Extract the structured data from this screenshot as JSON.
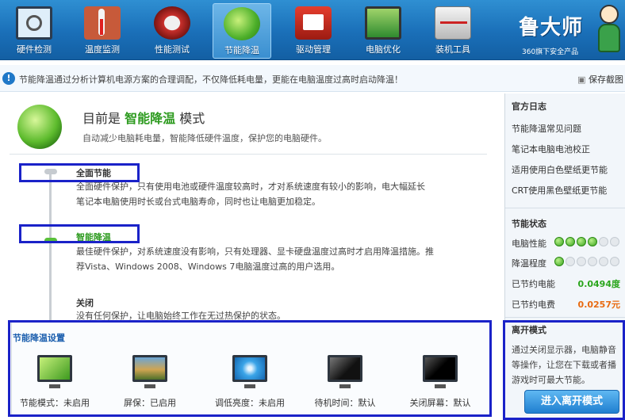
{
  "toolbar": {
    "tools": [
      {
        "label": "硬件检测",
        "icon": "monitor-magnifier-icon"
      },
      {
        "label": "温度监测",
        "icon": "thermometer-icon"
      },
      {
        "label": "性能测试",
        "icon": "gauge-icon"
      },
      {
        "label": "节能降温",
        "icon": "leaf-icon",
        "active": true
      },
      {
        "label": "驱动管理",
        "icon": "driver-box-icon"
      },
      {
        "label": "电脑优化",
        "icon": "screen-broom-icon"
      },
      {
        "label": "装机工具",
        "icon": "toolcase-icon"
      }
    ]
  },
  "brand": {
    "title": "鲁大师",
    "subtitle": "360旗下安全产品"
  },
  "notice": {
    "text": "节能降温通过分析计算机电源方案的合理调配，不仅降低耗电量，更能在电脑温度过高时启动降温！",
    "save_link": "保存截图"
  },
  "main": {
    "mode_prefix": "目前是",
    "mode_name": "智能降温",
    "mode_suffix": "模式",
    "mode_desc": "自动减少电脑耗电量，智能降低硬件温度，保护您的电脑硬件。",
    "options": [
      {
        "name": "全面节能",
        "lines": [
          "全面硬件保护，只有使用电池或硬件温度较高时，才对系统速度有较小的影响，电大幅延长",
          "笔记本电脑使用时长或台式电脑寿命，同时也让电脑更加稳定。"
        ]
      },
      {
        "name": "智能降温",
        "lines": [
          "最佳硬件保护，对系统速度没有影响，只有处理器、显卡硬盘温度过高时才启用降温措施。推",
          "荐Vista、Windows 2008、Windows 7电脑温度过高的用户选用。"
        ]
      },
      {
        "name": "关闭",
        "lines": [
          "没有任何保护，让电脑始终工作在无过热保护的状态。"
        ]
      }
    ]
  },
  "settings": {
    "title": "节能降温设置",
    "items": [
      {
        "label": "节能模式：未启用",
        "icon": "green-screen-icon"
      },
      {
        "label": "屏保：已启用",
        "icon": "photo-screen-icon"
      },
      {
        "label": "调低亮度：未启用",
        "icon": "blue-screen-icon"
      },
      {
        "label": "待机时间：默认",
        "icon": "dark-screen-icon"
      },
      {
        "label": "关闭屏幕：默认",
        "icon": "black-screen-icon"
      }
    ]
  },
  "sidebar": {
    "log_title": "官方日志",
    "links": [
      "节能降温常见问题",
      "笔记本电脑电池校正",
      "适用使用白色壁纸更节能",
      "CRT使用黑色壁纸更节能"
    ],
    "status_title": "节能状态",
    "perf_label": "电脑性能",
    "perf_level": 4,
    "temp_label": "降温程度",
    "temp_level": 1,
    "dots_total": 6,
    "saved_power_label": "已节约电能",
    "saved_power_value": "0.0494度",
    "saved_money_label": "已节约电费",
    "saved_money_value": "0.0257元",
    "leave_title": "离开模式",
    "leave_desc": [
      "通过关闭显示器，电脑静音",
      "等操作，让您在下载或者播",
      "游戏时可最大节能。"
    ],
    "leave_button": "进入离开模式"
  },
  "colors": {
    "toolbar": "#1a6fb8",
    "accent_green": "#2e9b20",
    "highlight_box": "#1a22c8",
    "saved_power": "#2aa51c",
    "saved_money": "#e86a10"
  }
}
